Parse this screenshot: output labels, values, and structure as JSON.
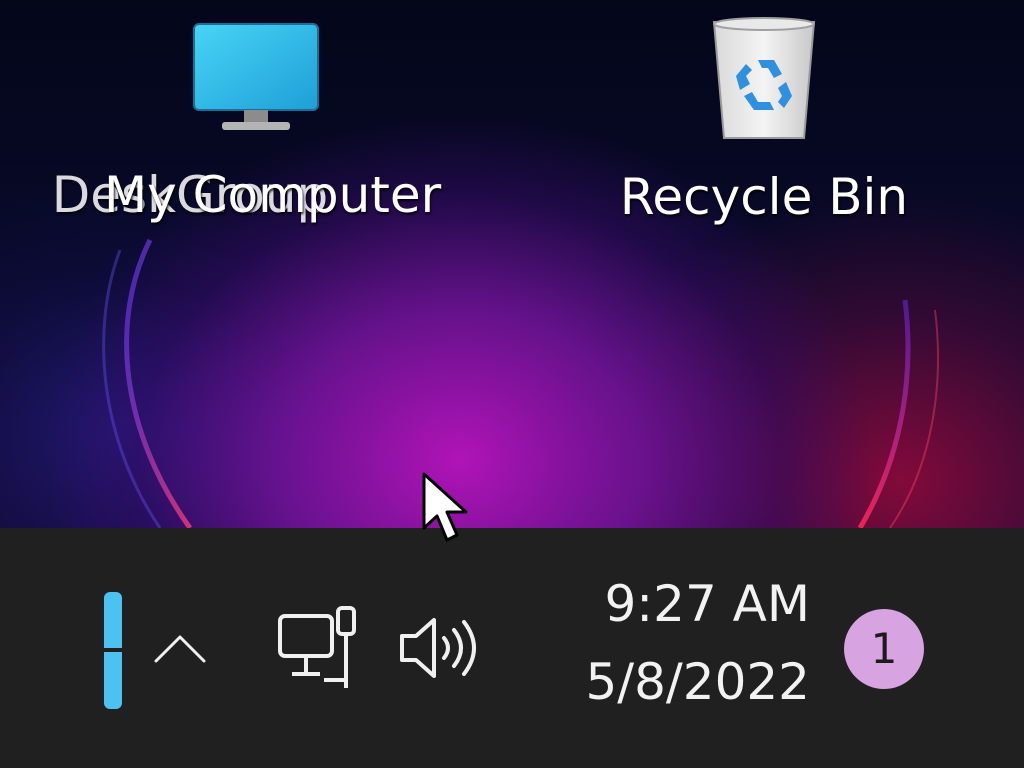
{
  "desktop": {
    "icons": [
      {
        "label": "My Computer",
        "overlap_label": "DeskGroup",
        "icon": "monitor-icon"
      },
      {
        "label": "Recycle Bin",
        "icon": "recycle-bin-icon"
      }
    ]
  },
  "taskbar": {
    "tray": {
      "overflow_icon": "chevron-up-icon",
      "network_icon": "network-icon",
      "volume_icon": "volume-icon"
    },
    "clock": {
      "time": "9:27 AM",
      "date": "5/8/2022"
    },
    "notifications": {
      "count": "1"
    }
  },
  "colors": {
    "taskbar": "#202020",
    "accent": "#4cc2f0",
    "badge": "#d7a3e0"
  }
}
